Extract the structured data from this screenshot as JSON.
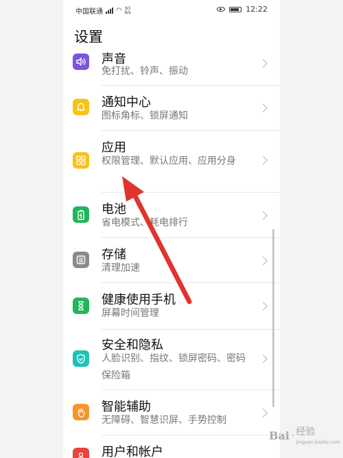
{
  "status_bar": {
    "carrier": "中国联通",
    "net_speed": "63\nB/s",
    "time": "12:22"
  },
  "page": {
    "title": "设置"
  },
  "settings_items": [
    {
      "title": "声音",
      "subtitle": "免打扰、铃声、振动",
      "icon": "speaker-icon",
      "icon_color": "#7b55e0"
    },
    {
      "title": "通知中心",
      "subtitle": "图标角标、锁屏通知",
      "icon": "bell-icon",
      "icon_color": "#f8c21b"
    },
    {
      "title": "应用",
      "subtitle": "权限管理、默认应用、应用分身",
      "icon": "apps-grid-icon",
      "icon_color": "#f8c21b"
    },
    {
      "title": "电池",
      "subtitle": "省电模式、耗电排行",
      "icon": "battery-icon",
      "icon_color": "#22b658"
    },
    {
      "title": "存储",
      "subtitle": "清理加速",
      "icon": "storage-icon",
      "icon_color": "#8a8a8a"
    },
    {
      "title": "健康使用手机",
      "subtitle": "屏幕时间管理",
      "icon": "hourglass-icon",
      "icon_color": "#22b658"
    },
    {
      "title": "安全和隐私",
      "subtitle": "人脸识别、指纹、锁屏密码、密码保险箱",
      "icon": "shield-icon",
      "icon_color": "#1ec2b6"
    },
    {
      "title": "智能辅助",
      "subtitle": "无障碍、智慧识屏、手势控制",
      "icon": "hand-icon",
      "icon_color": "#f5962a"
    },
    {
      "title": "用户和帐户",
      "subtitle": "",
      "icon": "user-icon",
      "icon_color": "#e8453c"
    }
  ],
  "annotation": {
    "arrow_color": "#e0342f"
  },
  "watermark": {
    "brand": "Bai",
    "suffix": "经验",
    "sub": "jingyan.baidu.com"
  }
}
